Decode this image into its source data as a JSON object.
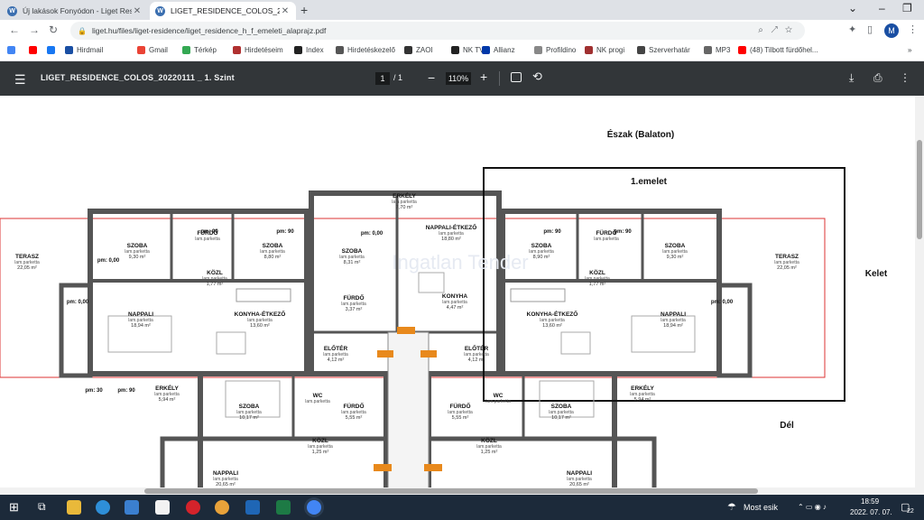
{
  "browser": {
    "tabs": [
      {
        "title": "Új lakások Fonyódon - Liget Resi",
        "icon": "wordpress-icon"
      },
      {
        "title": "LIGET_RESIDENCE_COLOS_20220",
        "icon": "wordpress-icon",
        "active": true
      }
    ],
    "url": "liget.hu/files/liget-residence/liget_residence_h_f_emeleti_alaprajz.pdf"
  },
  "bookmarks": [
    {
      "label": "",
      "color": "#4285f4"
    },
    {
      "label": "",
      "color": "#ff0000"
    },
    {
      "label": "",
      "color": "#1877f2"
    },
    {
      "label": "Hirdmail",
      "color": "#1a4fa3"
    },
    {
      "label": "Gmail",
      "color": "#ea4335"
    },
    {
      "label": "Térkép",
      "color": "#34a853"
    },
    {
      "label": "Hirdetéseim",
      "color": "#b03030"
    },
    {
      "label": "Index",
      "color": "#222222"
    },
    {
      "label": "Hirdetéskezelő",
      "color": "#555555"
    },
    {
      "label": "ZAOI",
      "color": "#333333"
    },
    {
      "label": "NK TV",
      "color": "#222222"
    },
    {
      "label": "Allianz",
      "color": "#0038a8"
    },
    {
      "label": "Profildino",
      "color": "#888888"
    },
    {
      "label": "NK progi",
      "color": "#a03030"
    },
    {
      "label": "Szerverhatár",
      "color": "#444444"
    },
    {
      "label": "MP3",
      "color": "#666666"
    },
    {
      "label": "(48) Tilbott fürdőhel...",
      "color": "#ff0000"
    }
  ],
  "pdf": {
    "title": "LIGET_RESIDENCE_COLOS_20220111 _ 1. Szint",
    "page_current": "1",
    "page_total": "/ 1",
    "zoom": "110%"
  },
  "plan": {
    "north": "Észak (Balaton)",
    "floor": "1.emelet",
    "east": "Kelet",
    "south": "Dél",
    "watermark": "Ingatlan Tender",
    "rooms": [
      {
        "name": "SZOBA",
        "area": "9,30 m²"
      },
      {
        "name": "FÜRDŐ",
        "area": ""
      },
      {
        "name": "SZOBA",
        "area": "8,80 m²"
      },
      {
        "name": "SZOBA",
        "area": "8,31 m²"
      },
      {
        "name": "NAPPALI-ÉTKEZŐ",
        "area": "18,80 m²"
      },
      {
        "name": "SZOBA",
        "area": "8,90 m²"
      },
      {
        "name": "FÜRDŐ",
        "area": ""
      },
      {
        "name": "SZOBA",
        "area": "9,30 m²"
      },
      {
        "name": "TERASZ",
        "area": "22,05 m²"
      },
      {
        "name": "TERASZ",
        "area": "22,05 m²"
      },
      {
        "name": "KÖZL",
        "area": "1,77 m²"
      },
      {
        "name": "KÖZL",
        "area": "1,77 m²"
      },
      {
        "name": "NAPPALI",
        "area": "18,94 m²"
      },
      {
        "name": "KONYHA-ÉTKEZŐ",
        "area": "13,60 m²"
      },
      {
        "name": "FÜRDŐ",
        "area": "3,37 m²"
      },
      {
        "name": "KONYHA",
        "area": "4,47 m²"
      },
      {
        "name": "KONYHA-ÉTKEZŐ",
        "area": "13,60 m²"
      },
      {
        "name": "NAPPALI",
        "area": "18,94 m²"
      },
      {
        "name": "ELŐTÉR",
        "area": "4,12 m²"
      },
      {
        "name": "ELŐTÉR",
        "area": "4,12 m²"
      },
      {
        "name": "ERKÉLY",
        "area": "7,70 m²"
      },
      {
        "name": "ERKÉLY",
        "area": "5,94 m²"
      },
      {
        "name": "ERKÉLY",
        "area": "5,94 m²"
      },
      {
        "name": "SZOBA",
        "area": "10,17 m²"
      },
      {
        "name": "WC",
        "area": ""
      },
      {
        "name": "FÜRDŐ",
        "area": "5,55 m²"
      },
      {
        "name": "FÜRDŐ",
        "area": "5,55 m²"
      },
      {
        "name": "WC",
        "area": ""
      },
      {
        "name": "SZOBA",
        "area": "10,17 m²"
      },
      {
        "name": "KÖZL",
        "area": "1,25 m²"
      },
      {
        "name": "KÖZL",
        "area": "1,25 m²"
      },
      {
        "name": "NAPPALI",
        "area": "20,65 m²"
      },
      {
        "name": "NAPPALI",
        "area": "20,65 m²"
      }
    ],
    "floor_type": "lam.parketta",
    "dims": [
      "pm: 90",
      "pm: 90",
      "pm: 90",
      "pm: 90",
      "pm: 0,00",
      "pm: 0,00",
      "pm: 0,00",
      "pm: 0,00",
      "pm: 30",
      "pm: 90"
    ]
  },
  "taskbar": {
    "weather": "Most esik",
    "time": "18:59",
    "date": "2022. 07. 07.",
    "notifications": "22"
  }
}
